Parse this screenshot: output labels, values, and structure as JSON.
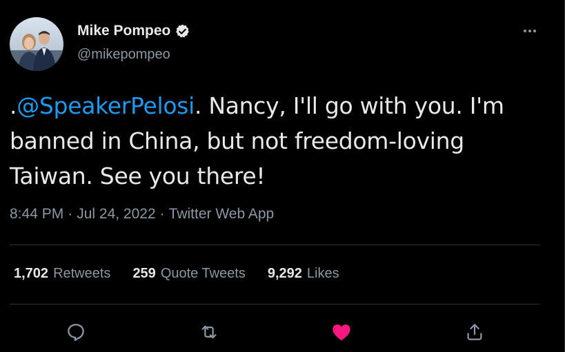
{
  "author": {
    "display_name": "Mike Pompeo",
    "handle": "@mikepompeo",
    "verified": true
  },
  "tweet": {
    "prefix": ".",
    "mention": "@SpeakerPelosi",
    "text_line1_rest": ". Nancy, I'll go with you. I'm",
    "text_line2": "banned in China, but not freedom-loving",
    "text_line3": "Taiwan.  See you there!"
  },
  "meta": {
    "time": "8:44 PM",
    "separator1": "·",
    "date": "Jul 24, 2022",
    "separator2": "·",
    "source": "Twitter Web App"
  },
  "stats": {
    "retweets_count": "1,702",
    "retweets_label": "Retweets",
    "quotes_count": "259",
    "quotes_label": "Quote Tweets",
    "likes_count": "9,292",
    "likes_label": "Likes"
  },
  "actions": {
    "reply_icon": "reply-icon",
    "retweet_icon": "retweet-icon",
    "like_icon": "heart-icon",
    "share_icon": "share-icon",
    "liked": true
  },
  "colors": {
    "background": "#000000",
    "text": "#e7e9ea",
    "secondary": "#8b98a5",
    "accent": "#1d9bf0",
    "like": "#f91880",
    "divider": "#2f3336"
  }
}
